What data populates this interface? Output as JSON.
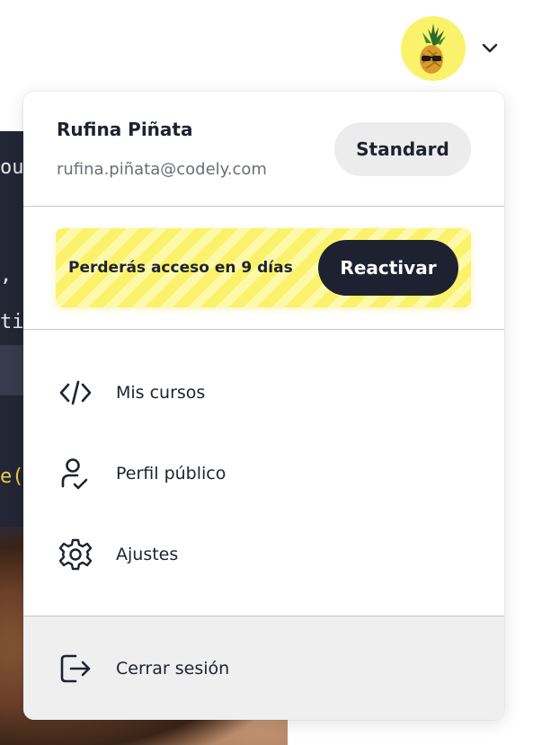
{
  "background": {
    "code_lines": [
      "ou",
      ",",
      "ti",
      "e("
    ]
  },
  "header": {
    "avatar_icon": "pineapple-avatar",
    "menu_toggle_icon": "chevron-down-icon"
  },
  "user": {
    "name": "Rufina Piñata",
    "email": "rufina.piñata@codely.com",
    "plan": "Standard"
  },
  "promo": {
    "text": "Perderás acceso en 9 días",
    "button_label": "Reactivar",
    "color": "#fbf26b"
  },
  "menu": {
    "items": [
      {
        "label": "Mis cursos",
        "icon": "code-icon"
      },
      {
        "label": "Perfil público",
        "icon": "user-check-icon"
      },
      {
        "label": "Ajustes",
        "icon": "gear-icon"
      }
    ],
    "logout": {
      "label": "Cerrar sesión",
      "icon": "logout-icon"
    }
  },
  "colors": {
    "accent_dark": "#1e2230",
    "accent_yellow": "#fbf26b",
    "badge_bg": "#ececec"
  }
}
